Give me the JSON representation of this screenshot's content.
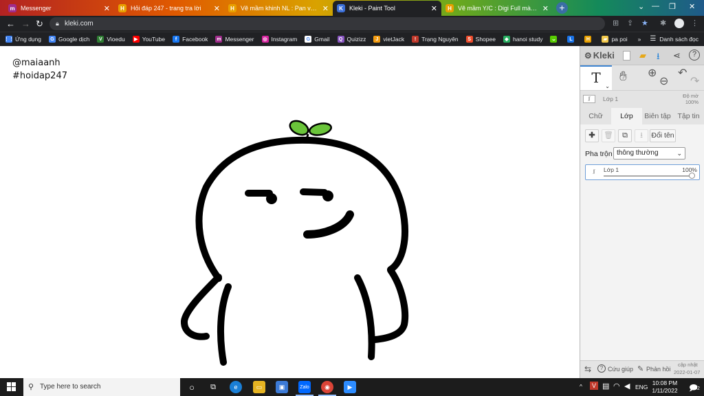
{
  "browser": {
    "tabs": [
      {
        "title": "Messenger",
        "icon": "messenger-icon",
        "color": "#a02c8c"
      },
      {
        "title": "Hỏi đáp 247 - trang tra lời",
        "icon": "hoidap-icon",
        "color": "#e8a000"
      },
      {
        "title": "Vẽ mầm khinh NL : Pan vẽ xấu m",
        "icon": "hoidap-icon",
        "color": "#e8a000"
      },
      {
        "title": "Kleki - Paint Tool",
        "icon": "kleki-icon",
        "color": "#3b6fd8"
      },
      {
        "title": "Vẽ mầm Y/C : Digi Full màu Có t",
        "icon": "hoidap-icon",
        "color": "#e8a000"
      }
    ],
    "new_tab": "+",
    "url": "kleki.com",
    "bookmarks": [
      {
        "label": "Ứng dụng",
        "icon": "apps-icon",
        "color": "#4285f4"
      },
      {
        "label": "Google dịch",
        "icon": "translate-icon",
        "color": "#4285f4"
      },
      {
        "label": "Vioedu",
        "icon": "vioedu-icon",
        "color": "#2e7d32"
      },
      {
        "label": "YouTube",
        "icon": "youtube-icon",
        "color": "#ff0000"
      },
      {
        "label": "Facebook",
        "icon": "facebook-icon",
        "color": "#1877f2"
      },
      {
        "label": "Messenger",
        "icon": "messenger-icon",
        "color": "#a02c8c"
      },
      {
        "label": "Instagram",
        "icon": "instagram-icon",
        "color": "#d6249f"
      },
      {
        "label": "Gmail",
        "icon": "google-icon",
        "color": "#ffffff"
      },
      {
        "label": "Quizizz",
        "icon": "quizizz-icon",
        "color": "#8854c0"
      },
      {
        "label": "vietJack",
        "icon": "vietjack-icon",
        "color": "#f39c12"
      },
      {
        "label": "Trạng Nguyên",
        "icon": "trangnguyen-icon",
        "color": "#c0392b"
      },
      {
        "label": "Shopee",
        "icon": "shopee-icon",
        "color": "#ee4d2d"
      },
      {
        "label": "hanoi study",
        "icon": "hanoistudy-icon",
        "color": "#27ae60"
      },
      {
        "label": "",
        "icon": "duolingo-icon",
        "color": "#58cc02"
      },
      {
        "label": "",
        "icon": "l-icon",
        "color": "#1a73e8"
      },
      {
        "label": "",
        "icon": "hoidap-icon",
        "color": "#e8a000"
      },
      {
        "label": "pa poi",
        "icon": "folder-icon",
        "color": "#f2c94c"
      }
    ],
    "bookmarks_overflow": "»",
    "reading_list": "Danh sách đọc"
  },
  "canvas": {
    "signature_line1": "@maiaanh",
    "signature_line2": "#hoidap247",
    "sprout_color": "#6ac43a",
    "stroke_color": "#000000"
  },
  "kleki": {
    "app_name": "Kleki",
    "tool_text_glyph": "T",
    "layer_name": "Lớp 1",
    "opacity_label": "Độ mờ",
    "opacity_value": "100%",
    "tabs": [
      "Chữ",
      "Lớp",
      "Biên tập",
      "Tập tin"
    ],
    "active_tab": "Lớp",
    "rename_button": "Đổi tên",
    "blend_label": "Pha trộn",
    "blend_value": "thông thường",
    "layer_item_name": "Lớp 1",
    "layer_item_opacity": "100%",
    "layer_opacity": 1.0,
    "help_label": "Cứu giúp",
    "feedback_label": "Phản hồi",
    "updated_label": "cập nhật",
    "updated_date": "2022-01-07"
  },
  "taskbar": {
    "search_placeholder": "Type here to search",
    "language": "ENG",
    "time": "10:08 PM",
    "date": "1/11/2022",
    "notification_count": "2"
  }
}
